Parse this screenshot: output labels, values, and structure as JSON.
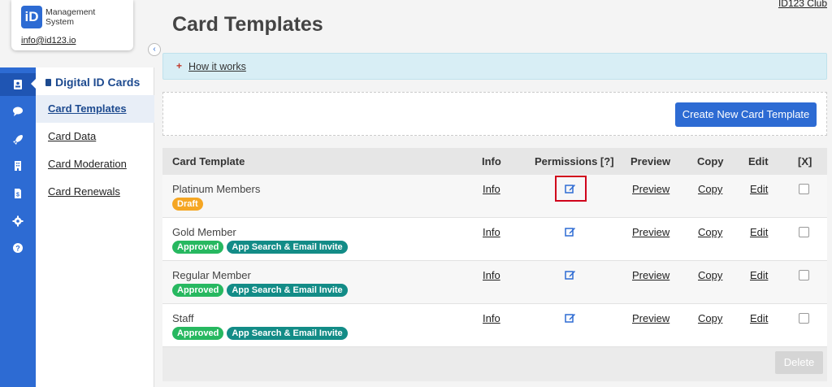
{
  "logo": {
    "mark": "iD",
    "line1": "Management",
    "line2": "System",
    "email": "info@id123.io"
  },
  "club_link": "ID123 Club",
  "page_title": "Card Templates",
  "info_banner": {
    "link": "How it works"
  },
  "create_button": "Create New Card Template",
  "rail_icons": [
    "id-card-icon",
    "chat-icon",
    "rocket-icon",
    "building-icon",
    "invoice-icon",
    "gear-icon",
    "help-icon"
  ],
  "subnav": {
    "title": "Digital ID Cards",
    "items": [
      {
        "label": "Card Templates",
        "active": true
      },
      {
        "label": "Card Data",
        "active": false
      },
      {
        "label": "Card Moderation",
        "active": false
      },
      {
        "label": "Card Renewals",
        "active": false
      }
    ]
  },
  "table": {
    "headers": {
      "template": "Card Template",
      "info": "Info",
      "permissions": "Permissions [?]",
      "preview": "Preview",
      "copy": "Copy",
      "edit": "Edit",
      "x": "[X]"
    },
    "rows": [
      {
        "name": "Platinum Members",
        "status": "Draft",
        "tag": "",
        "info": "Info",
        "preview": "Preview",
        "copy": "Copy",
        "edit": "Edit"
      },
      {
        "name": "Gold Member",
        "status": "Approved",
        "tag": "App Search & Email Invite",
        "info": "Info",
        "preview": "Preview",
        "copy": "Copy",
        "edit": "Edit"
      },
      {
        "name": "Regular Member",
        "status": "Approved",
        "tag": "App Search & Email Invite",
        "info": "Info",
        "preview": "Preview",
        "copy": "Copy",
        "edit": "Edit"
      },
      {
        "name": "Staff",
        "status": "Approved",
        "tag": "App Search & Email Invite",
        "info": "Info",
        "preview": "Preview",
        "copy": "Copy",
        "edit": "Edit"
      }
    ],
    "delete_label": "Delete"
  },
  "colors": {
    "brand": "#2d6bd3",
    "draft": "#f5a623",
    "approved": "#27b860",
    "invite": "#138c87",
    "highlight": "#d0021b"
  }
}
